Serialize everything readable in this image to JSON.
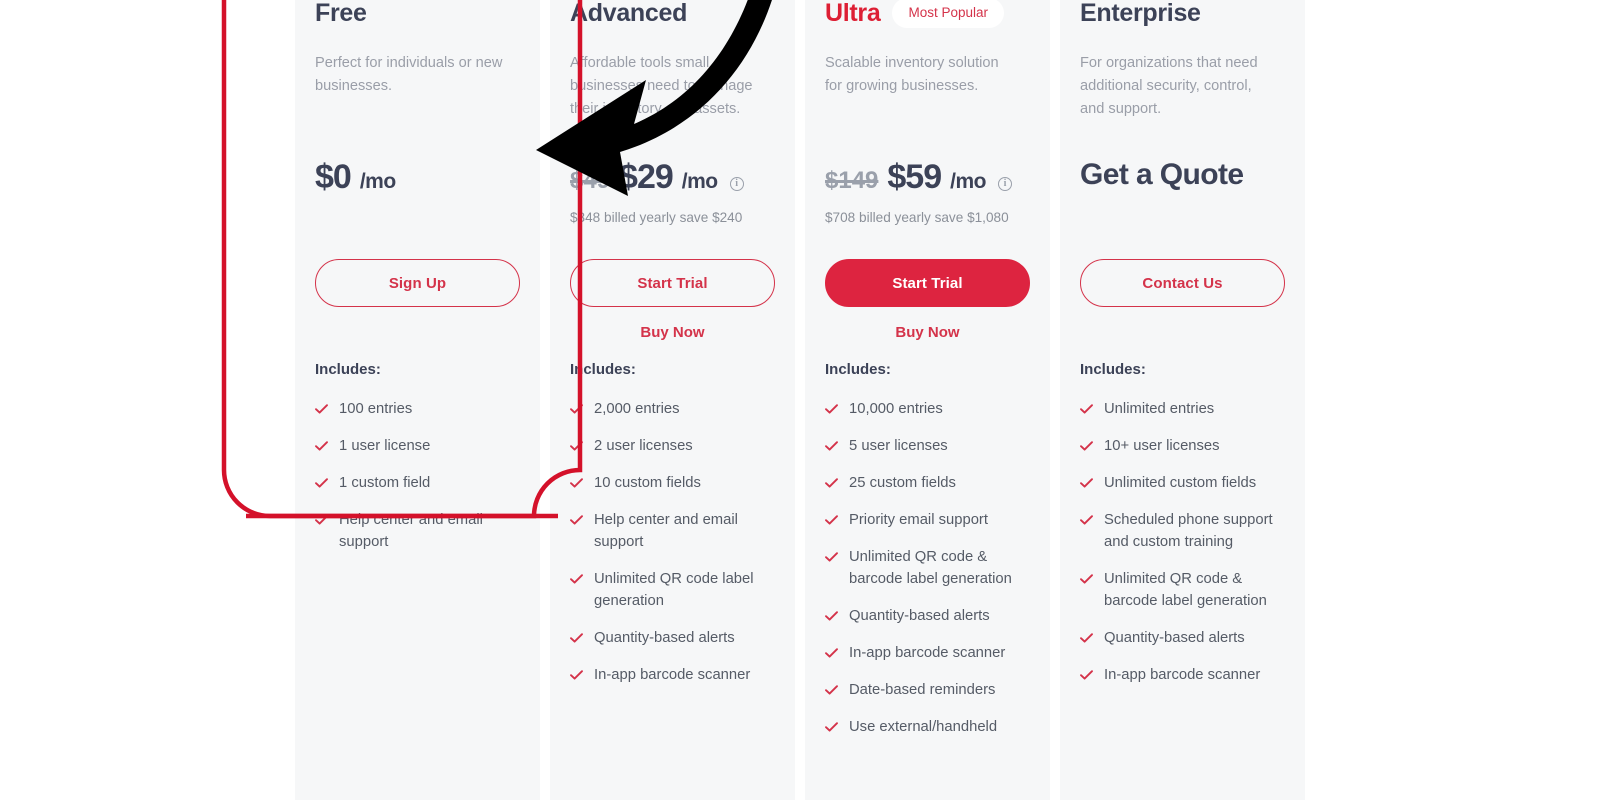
{
  "plans": [
    {
      "name": "Free",
      "accent": false,
      "badge": null,
      "description": "Perfect for individuals or new businesses.",
      "old_price": null,
      "price": "$0",
      "per": "/mo",
      "has_info_icon": false,
      "billed_note": null,
      "quote_text": null,
      "cta_label": "Sign Up",
      "cta_filled": false,
      "secondary_cta": null,
      "includes_label": "Includes:",
      "features": [
        "100 entries",
        "1 user license",
        "1 custom field",
        "Help center and email support"
      ]
    },
    {
      "name": "Advanced",
      "accent": false,
      "badge": null,
      "description": "Affordable tools small businesses need to manage their inventory and assets.",
      "old_price": "$49",
      "price": "$29",
      "per": "/mo",
      "has_info_icon": true,
      "billed_note": "$348 billed yearly save $240",
      "quote_text": null,
      "cta_label": "Start Trial",
      "cta_filled": false,
      "secondary_cta": "Buy Now",
      "includes_label": "Includes:",
      "features": [
        "2,000 entries",
        "2 user licenses",
        "10 custom fields",
        "Help center and email support",
        "Unlimited QR code label generation",
        "Quantity-based alerts",
        "In-app barcode scanner"
      ]
    },
    {
      "name": "Ultra",
      "accent": true,
      "badge": "Most Popular",
      "description": "Scalable inventory solution for growing businesses.",
      "old_price": "$149",
      "price": "$59",
      "per": "/mo",
      "has_info_icon": true,
      "billed_note": "$708 billed yearly save $1,080",
      "quote_text": null,
      "cta_label": "Start Trial",
      "cta_filled": true,
      "secondary_cta": "Buy Now",
      "includes_label": "Includes:",
      "features": [
        "10,000 entries",
        "5 user licenses",
        "25 custom fields",
        "Priority email support",
        "Unlimited QR code & barcode label generation",
        "Quantity-based alerts",
        "In-app barcode scanner",
        "Date-based reminders",
        "Use external/handheld"
      ]
    },
    {
      "name": "Enterprise",
      "accent": false,
      "badge": null,
      "description": "For organizations that need additional security, control, and support.",
      "old_price": null,
      "price": null,
      "per": null,
      "has_info_icon": false,
      "billed_note": null,
      "quote_text": "Get a Quote",
      "cta_label": "Contact Us",
      "cta_filled": false,
      "secondary_cta": null,
      "includes_label": "Includes:",
      "features": [
        "Unlimited entries",
        "10+ user licenses",
        "Unlimited custom fields",
        "Scheduled phone support and custom training",
        "Unlimited QR code & barcode label generation",
        "Quantity-based alerts",
        "In-app barcode scanner"
      ]
    }
  ],
  "annotation": {
    "highlight_color": "#d4112a",
    "arrow_color": "#000000"
  },
  "colors": {
    "accent_red": "#d4334a",
    "filled_red": "#dd2440",
    "title_red": "#dd1f34",
    "text_dark": "#3c4257",
    "text_muted": "#9a9ea8",
    "card_bg": "#f6f7f8",
    "page_bg": "#ffffff"
  }
}
